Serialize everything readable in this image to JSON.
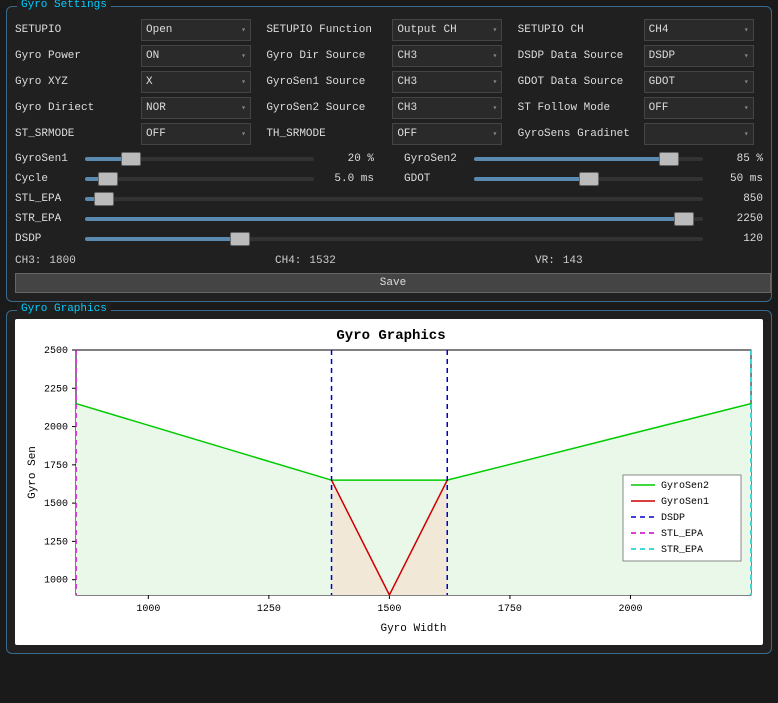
{
  "settings": {
    "title": "Gyro Settings",
    "grid": [
      [
        {
          "label": "SETUPIO",
          "value": "Open"
        },
        {
          "label": "SETUPIO Function",
          "value": "Output CH"
        },
        {
          "label": "SETUPIO CH",
          "value": "CH4"
        }
      ],
      [
        {
          "label": "Gyro Power",
          "value": "ON"
        },
        {
          "label": "Gyro Dir Source",
          "value": "CH3"
        },
        {
          "label": "DSDP Data Source",
          "value": "DSDP"
        }
      ],
      [
        {
          "label": "Gyro XYZ",
          "value": "X"
        },
        {
          "label": "GyroSen1 Source",
          "value": "CH3"
        },
        {
          "label": "GDOT Data Source",
          "value": "GDOT"
        }
      ],
      [
        {
          "label": "Gyro Diriect",
          "value": "NOR"
        },
        {
          "label": "GyroSen2 Source",
          "value": "CH3"
        },
        {
          "label": "ST Follow Mode",
          "value": "OFF"
        }
      ],
      [
        {
          "label": "ST_SRMODE",
          "value": "OFF"
        },
        {
          "label": "TH_SRMODE",
          "value": "OFF"
        },
        {
          "label": "GyroSens Gradinet",
          "value": "",
          "disabled": true
        }
      ]
    ],
    "sliders_half": [
      {
        "label": "GyroSen1",
        "value": "20 %",
        "pct": 20
      },
      {
        "label": "GyroSen2",
        "value": "85 %",
        "pct": 85
      },
      {
        "label": "Cycle",
        "value": "5.0 ms",
        "pct": 10
      },
      {
        "label": "GDOT",
        "value": "50 ms",
        "pct": 50
      }
    ],
    "sliders_full": [
      {
        "label": "STL_EPA",
        "value": "850",
        "pct": 3
      },
      {
        "label": "STR_EPA",
        "value": "2250",
        "pct": 97
      },
      {
        "label": "DSDP",
        "value": "120",
        "pct": 25
      }
    ],
    "status": [
      {
        "label": "CH3:",
        "value": "1800"
      },
      {
        "label": "CH4:",
        "value": "1532"
      },
      {
        "label": "VR:",
        "value": "143"
      }
    ],
    "save": "Save"
  },
  "graphics": {
    "title": "Gyro Graphics",
    "chart_title": "Gyro Graphics",
    "xlabel": "Gyro Width",
    "ylabel": "Gyro Sen",
    "legend": [
      "GyroSen2",
      "GyroSen1",
      "DSDP",
      "STL_EPA",
      "STR_EPA"
    ]
  },
  "chart_data": {
    "type": "line",
    "xlim": [
      850,
      2250
    ],
    "ylim": [
      900,
      2500
    ],
    "xticks": [
      1000,
      1250,
      1500,
      1750,
      2000
    ],
    "yticks": [
      1000,
      1250,
      1500,
      1750,
      2000,
      2250,
      2500
    ],
    "series": [
      {
        "name": "GyroSen2",
        "color": "#00cc00",
        "x": [
          850,
          1380,
          1620,
          2250
        ],
        "y": [
          2150,
          1650,
          1650,
          2150
        ],
        "fill": "#eaf8ea"
      },
      {
        "name": "GyroSen1",
        "color": "#cc0000",
        "x": [
          1380,
          1500,
          1620
        ],
        "y": [
          1650,
          900,
          1650
        ],
        "fill": "#f2e8d8"
      }
    ],
    "vlines": [
      {
        "name": "DSDP",
        "x": 1380,
        "color": "#0000cc",
        "dash": true
      },
      {
        "name": "DSDP",
        "x": 1620,
        "color": "#0000cc",
        "dash": true
      },
      {
        "name": "STL_EPA",
        "x": 850,
        "color": "#cc00cc",
        "dash": true
      },
      {
        "name": "STR_EPA",
        "x": 2250,
        "color": "#00cccc",
        "dash": true
      }
    ]
  }
}
